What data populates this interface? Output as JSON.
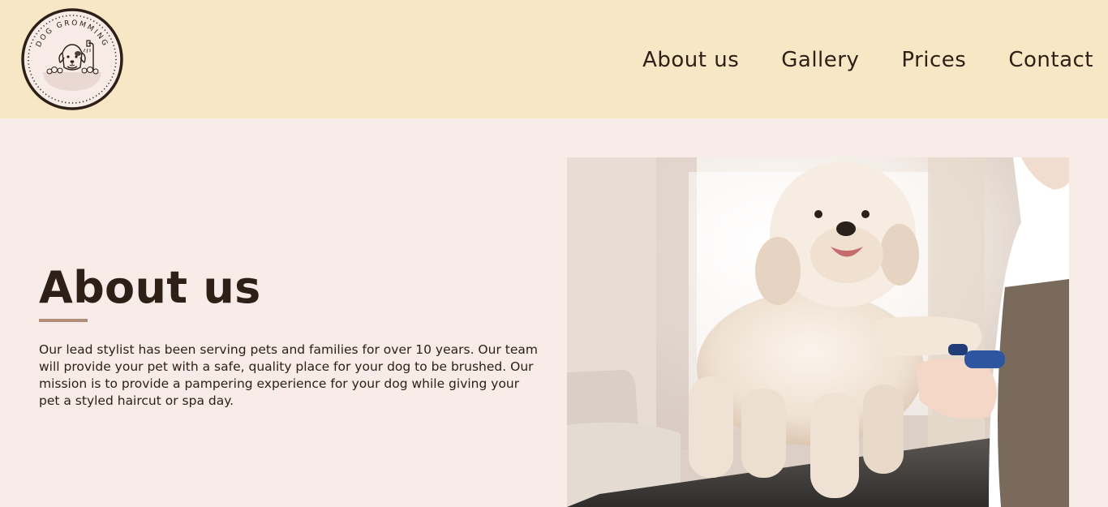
{
  "header": {
    "logo": {
      "text": "DOG GROMMING",
      "icon": "dog-in-bathtub-logo"
    },
    "nav": [
      {
        "label": "About us"
      },
      {
        "label": "Gallery"
      },
      {
        "label": "Prices"
      },
      {
        "label": "Contact"
      }
    ]
  },
  "main": {
    "title": "About us",
    "body": "Our lead stylist has been serving pets and families for over 10 years. Our team will provide your pet with a safe, quality place for your dog to be brushed. Our mission is to provide a pampering experience for your dog while giving your pet a styled haircut or spa day.",
    "photo": {
      "subject": "dog-grooming-photo"
    }
  },
  "colors": {
    "header_bg": "#f7e7c4",
    "page_bg": "#f7ece7",
    "text": "#2e2017",
    "accent": "#b08e7a"
  }
}
